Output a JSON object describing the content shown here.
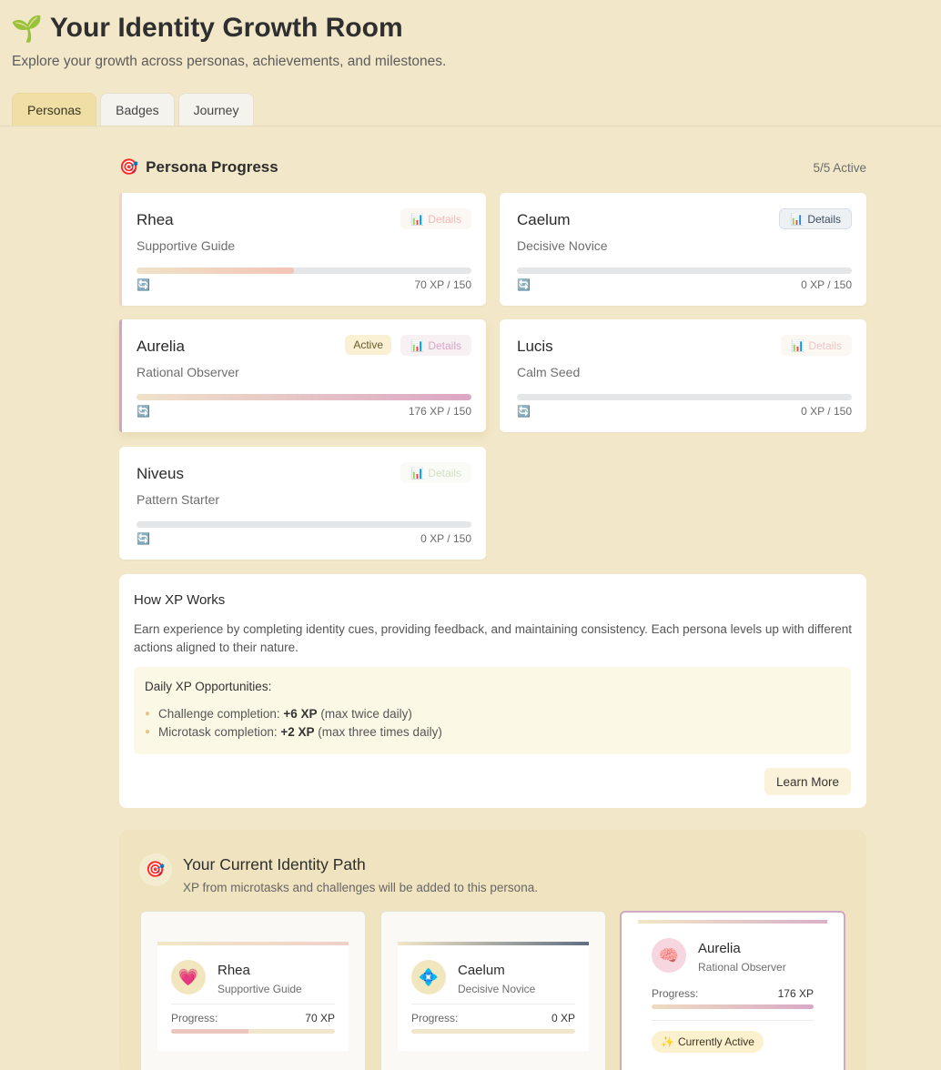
{
  "header": {
    "emoji": "🌱",
    "title": "Your Identity Growth Room",
    "subtitle": "Explore your growth across personas, achievements, and milestones."
  },
  "tabs": [
    {
      "label": "Personas",
      "active": true
    },
    {
      "label": "Badges",
      "active": false
    },
    {
      "label": "Journey",
      "active": false
    }
  ],
  "persona_progress": {
    "icon": "🎯",
    "title": "Persona Progress",
    "active_count": "5/5 Active",
    "details_label": "Details",
    "active_label": "Active",
    "refresh_icon": "🔄",
    "cards": [
      {
        "name": "Rhea",
        "role": "Supportive Guide",
        "xp": "70 XP / 150",
        "progress": 0.47,
        "accent": "#f3c7c2",
        "fill": "#f2c3b8"
      },
      {
        "name": "Caelum",
        "role": "Decisive Novice",
        "xp": "0 XP / 150",
        "progress": 0,
        "accent": "#ffffff",
        "fill": "#8a9fb3"
      },
      {
        "name": "Aurelia",
        "role": "Rational Observer",
        "xp": "176 XP / 150",
        "progress": 1,
        "accent": "#d3a3c5",
        "fill": "#dfa9c8"
      },
      {
        "name": "Lucis",
        "role": "Calm Seed",
        "xp": "0 XP / 150",
        "progress": 0,
        "accent": "#ffffff",
        "fill": "#f0c4c4"
      },
      {
        "name": "Niveus",
        "role": "Pattern Starter",
        "xp": "0 XP / 150",
        "progress": 0,
        "accent": "#ffffff",
        "fill": "#cfe0c4"
      }
    ]
  },
  "xp_info": {
    "title": "How XP Works",
    "description": "Earn experience by completing identity cues, providing feedback, and maintaining consistency. Each persona levels up with different actions aligned to their nature.",
    "opportunities_title": "Daily XP Opportunities:",
    "items": [
      {
        "label": "Challenge completion:",
        "amount": "+6 XP",
        "note": "(max twice daily)"
      },
      {
        "label": "Microtask completion:",
        "amount": "+2 XP",
        "note": "(max three times daily)"
      }
    ],
    "learn_more": "Learn More"
  },
  "identity_path": {
    "icon": "🎯",
    "title": "Your Current Identity Path",
    "subtitle": "XP from microtasks and challenges will be added to this persona.",
    "progress_label": "Progress:",
    "currently_active": "Currently Active",
    "sparkle": "✨",
    "personas": [
      {
        "name": "Rhea",
        "role": "Supportive Guide",
        "icon": "💗",
        "xp": "70 XP",
        "progress": 0.47,
        "strip": "#f0d6c8",
        "fill": "#edc9c0",
        "selected": false
      },
      {
        "name": "Caelum",
        "role": "Decisive Novice",
        "icon": "💠",
        "xp": "0 XP",
        "progress": 0,
        "strip": "#5f6f82",
        "fill": "#5f6f82",
        "selected": false
      },
      {
        "name": "Aurelia",
        "role": "Rational Observer",
        "icon": "🧠",
        "xp": "176 XP",
        "progress": 1,
        "strip": "#dcb3cb",
        "fill": "#dcaac6",
        "selected": true
      }
    ]
  }
}
